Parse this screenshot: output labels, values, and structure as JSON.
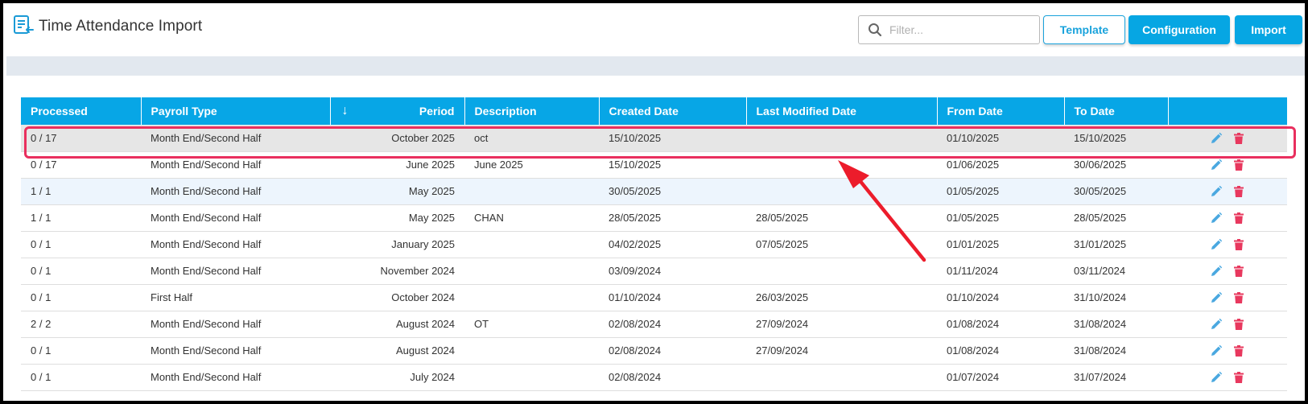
{
  "header": {
    "title": "Time Attendance Import",
    "filter_placeholder": "Filter...",
    "template_label": "Template",
    "configuration_label": "Configuration",
    "import_label": "Import"
  },
  "table": {
    "columns": [
      "Processed",
      "Payroll Type",
      "Period",
      "Description",
      "Created Date",
      "Last Modified Date",
      "From Date",
      "To Date",
      ""
    ],
    "rows": [
      {
        "processed": "0 / 17",
        "payroll_type": "Month End/Second Half",
        "period": "October 2025",
        "description": "oct",
        "created": "15/10/2025",
        "modified": "",
        "from": "01/10/2025",
        "to": "15/10/2025"
      },
      {
        "processed": "0 / 17",
        "payroll_type": "Month End/Second Half",
        "period": "June 2025",
        "description": "June 2025",
        "created": "15/10/2025",
        "modified": "",
        "from": "01/06/2025",
        "to": "30/06/2025"
      },
      {
        "processed": "1 / 1",
        "payroll_type": "Month End/Second Half",
        "period": "May 2025",
        "description": "",
        "created": "30/05/2025",
        "modified": "",
        "from": "01/05/2025",
        "to": "30/05/2025"
      },
      {
        "processed": "1 / 1",
        "payroll_type": "Month End/Second Half",
        "period": "May 2025",
        "description": "CHAN",
        "created": "28/05/2025",
        "modified": "28/05/2025",
        "from": "01/05/2025",
        "to": "28/05/2025"
      },
      {
        "processed": "0 / 1",
        "payroll_type": "Month End/Second Half",
        "period": "January 2025",
        "description": "",
        "created": "04/02/2025",
        "modified": "07/05/2025",
        "from": "01/01/2025",
        "to": "31/01/2025"
      },
      {
        "processed": "0 / 1",
        "payroll_type": "Month End/Second Half",
        "period": "November 2024",
        "description": "",
        "created": "03/09/2024",
        "modified": "",
        "from": "01/11/2024",
        "to": "03/11/2024"
      },
      {
        "processed": "0 / 1",
        "payroll_type": "First Half",
        "period": "October 2024",
        "description": "",
        "created": "01/10/2024",
        "modified": "26/03/2025",
        "from": "01/10/2024",
        "to": "31/10/2024"
      },
      {
        "processed": "2 / 2",
        "payroll_type": "Month End/Second Half",
        "period": "August 2024",
        "description": "OT",
        "created": "02/08/2024",
        "modified": "27/09/2024",
        "from": "01/08/2024",
        "to": "31/08/2024"
      },
      {
        "processed": "0 / 1",
        "payroll_type": "Month End/Second Half",
        "period": "August 2024",
        "description": "",
        "created": "02/08/2024",
        "modified": "27/09/2024",
        "from": "01/08/2024",
        "to": "31/08/2024"
      },
      {
        "processed": "0 / 1",
        "payroll_type": "Month End/Second Half",
        "period": "July 2024",
        "description": "",
        "created": "02/08/2024",
        "modified": "",
        "from": "01/07/2024",
        "to": "31/07/2024"
      }
    ]
  },
  "icons": {
    "app": "import-list-icon",
    "search": "search-icon",
    "sort": "sort-down-arrow-icon",
    "edit": "pencil-edit-icon",
    "delete": "trash-delete-icon"
  },
  "colors": {
    "accent": "#06a6e3",
    "highlight": "#e92f5e",
    "delete": "#e8385e",
    "edit": "#4aa8e0"
  }
}
